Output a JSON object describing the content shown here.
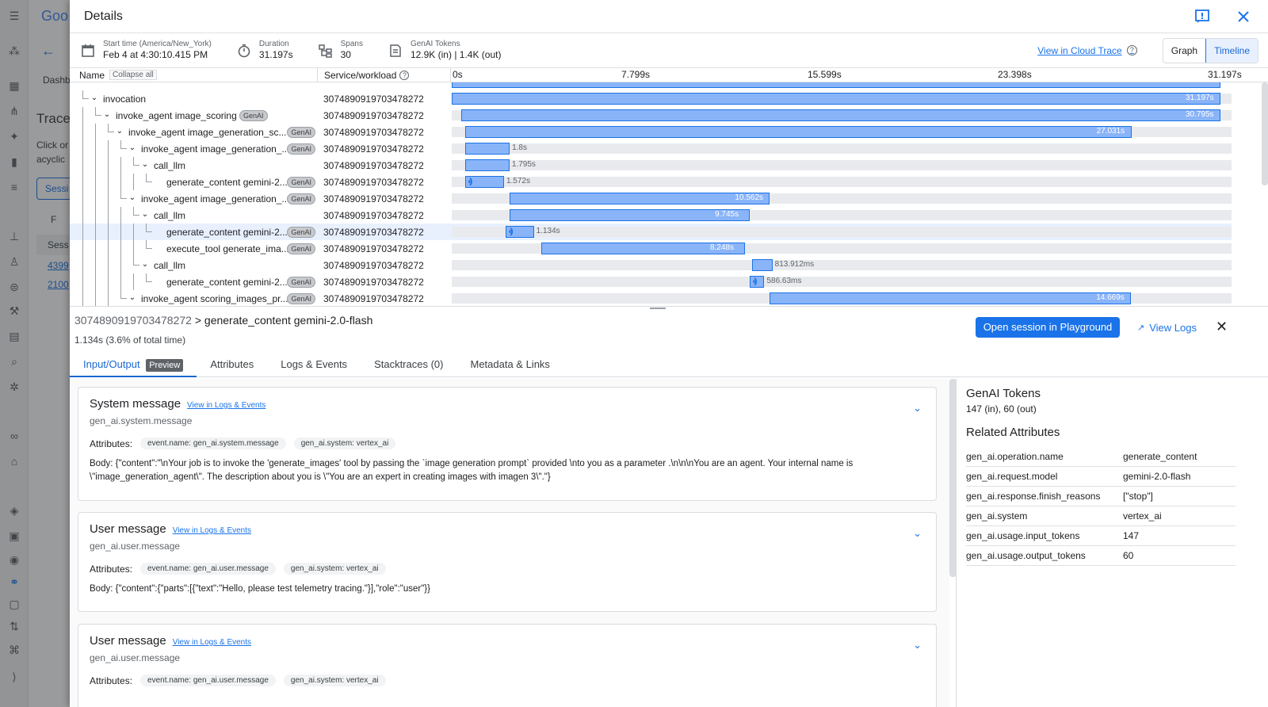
{
  "background": {
    "header_logo": "Goo",
    "dash_label": "Dashb",
    "trace_heading": "Trace",
    "desc_line1": "Click or",
    "desc_line2": "acyclic",
    "session_tab": "Sessi",
    "filter_label": "F",
    "table_header": "Sess",
    "row1": "4399",
    "row2": "2100"
  },
  "dialog": {
    "title": "Details"
  },
  "summary": {
    "start_time_label": "Start time (America/New_York)",
    "start_time_value": "Feb 4 at 4:30:10.415 PM",
    "duration_label": "Duration",
    "duration_value": "31.197s",
    "spans_label": "Spans",
    "spans_value": "30",
    "tokens_label": "GenAI Tokens",
    "tokens_value": "12.9K (in) | 1.4K (out)",
    "cloud_trace_link": "View in Cloud Trace",
    "graph_btn": "Graph",
    "timeline_btn": "Timeline"
  },
  "trace_table": {
    "col_name": "Name",
    "collapse_all": "Collapse all",
    "col_service": "Service/workload",
    "ticks": [
      "0s",
      "7.799s",
      "15.599s",
      "23.398s",
      "31.197s"
    ],
    "total_duration_s": 31.197,
    "rows": [
      {
        "name": "invocation",
        "depth": 0,
        "genai": false,
        "service": "3074890919703478272",
        "start": 0,
        "duration": 31.197,
        "label": "31.197s"
      },
      {
        "name": "invoke_agent image_scoring",
        "depth": 1,
        "genai": true,
        "service": "3074890919703478272",
        "start": 0.4,
        "duration": 30.795,
        "label": "30.795s"
      },
      {
        "name": "invoke_agent image_generation_sc...",
        "depth": 2,
        "genai": true,
        "service": "3074890919703478272",
        "start": 0.55,
        "duration": 27.031,
        "label": "27.031s"
      },
      {
        "name": "invoke_agent image_generation_...",
        "depth": 3,
        "genai": true,
        "service": "3074890919703478272",
        "start": 0.55,
        "duration": 1.8,
        "label": "1.8s"
      },
      {
        "name": "call_llm",
        "depth": 4,
        "genai": false,
        "service": "3074890919703478272",
        "start": 0.55,
        "duration": 1.795,
        "label": "1.795s"
      },
      {
        "name": "generate_content gemini-2...",
        "depth": 5,
        "genai": true,
        "service": "3074890919703478272",
        "start": 0.55,
        "duration": 1.572,
        "label": "1.572s",
        "dots": true
      },
      {
        "name": "invoke_agent image_generation_...",
        "depth": 3,
        "genai": true,
        "service": "3074890919703478272",
        "start": 2.35,
        "duration": 10.562,
        "label": "10.562s"
      },
      {
        "name": "call_llm",
        "depth": 4,
        "genai": false,
        "service": "3074890919703478272",
        "start": 2.35,
        "duration": 9.745,
        "label": "9.745s"
      },
      {
        "name": "generate_content gemini-2...",
        "depth": 5,
        "genai": true,
        "service": "3074890919703478272",
        "start": 2.2,
        "duration": 1.134,
        "label": "1.134s",
        "dots": true,
        "selected": true
      },
      {
        "name": "execute_tool generate_ima...",
        "depth": 5,
        "genai": true,
        "service": "3074890919703478272",
        "start": 3.65,
        "duration": 8.248,
        "label": "8.248s"
      },
      {
        "name": "call_llm",
        "depth": 4,
        "genai": false,
        "service": "3074890919703478272",
        "start": 12.2,
        "duration": 0.814,
        "label": "813.912ms"
      },
      {
        "name": "generate_content gemini-2...",
        "depth": 5,
        "genai": true,
        "service": "3074890919703478272",
        "start": 12.1,
        "duration": 0.587,
        "label": "586.63ms",
        "dots": true
      },
      {
        "name": "invoke_agent scoring_images_pr...",
        "depth": 3,
        "genai": true,
        "service": "3074890919703478272",
        "start": 12.9,
        "duration": 14.669,
        "label": "14.669s"
      }
    ]
  },
  "detail": {
    "breadcrumb_id": "3074890919703478272",
    "breadcrumb_sep": ">",
    "breadcrumb_name": "generate_content gemini-2.0-flash",
    "duration_line": "1.134s  (3.6% of total time)",
    "open_playground": "Open session in Playground",
    "view_logs": "View Logs",
    "tabs": [
      "Input/Output",
      "Attributes",
      "Logs & Events",
      "Stacktraces (0)",
      "Metadata & Links"
    ],
    "preview_chip": "Preview"
  },
  "messages": [
    {
      "title": "System message",
      "link": "View in Logs & Events",
      "sub": "gen_ai.system.message",
      "attrs_label": "Attributes:",
      "chips": [
        "event.name: gen_ai.system.message",
        "gen_ai.system: vertex_ai"
      ],
      "body": "Body: {\"content\":\"\\nYour job is to invoke the 'generate_images' tool by passing the `image generation prompt` provided \\nto you as a parameter .\\n\\n\\nYou are an agent. Your internal name is \\\"image_generation_agent\\\". The description about you is \\\"You are an expert in creating images with imagen 3\\\".\"}"
    },
    {
      "title": "User message",
      "link": "View in Logs & Events",
      "sub": "gen_ai.user.message",
      "attrs_label": "Attributes:",
      "chips": [
        "event.name: gen_ai.user.message",
        "gen_ai.system: vertex_ai"
      ],
      "body": "Body: {\"content\":{\"parts\":[{\"text\":\"Hello, please test telemetry tracing.\"}],\"role\":\"user\"}}"
    },
    {
      "title": "User message",
      "link": "View in Logs & Events",
      "sub": "gen_ai.user.message",
      "attrs_label": "Attributes:",
      "chips": [
        "event.name: gen_ai.user.message",
        "gen_ai.system: vertex_ai"
      ],
      "body": ""
    }
  ],
  "side_panel": {
    "tokens_title": "GenAI Tokens",
    "tokens_value": "147 (in), 60 (out)",
    "related_title": "Related Attributes",
    "attributes": [
      [
        "gen_ai.operation.name",
        "generate_content"
      ],
      [
        "gen_ai.request.model",
        "gemini-2.0-flash"
      ],
      [
        "gen_ai.response.finish_reasons",
        "[\"stop\"]"
      ],
      [
        "gen_ai.system",
        "vertex_ai"
      ],
      [
        "gen_ai.usage.input_tokens",
        "147"
      ],
      [
        "gen_ai.usage.output_tokens",
        "60"
      ]
    ]
  },
  "icons": {
    "menu": "menu-icon",
    "back": "arrow-back-icon",
    "feedback": "feedback-icon",
    "close": "close-icon",
    "calendar": "calendar-icon",
    "timer": "timer-icon",
    "spans": "spans-icon",
    "tokens": "tokens-icon"
  }
}
